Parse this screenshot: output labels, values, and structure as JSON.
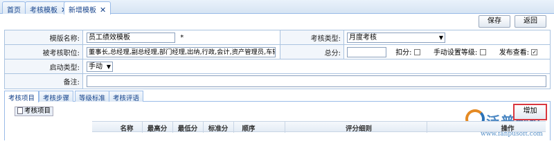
{
  "top_tabs": [
    {
      "label": "首页",
      "closable": false
    },
    {
      "label": "考核模板",
      "closable": true
    },
    {
      "label": "新增模板",
      "closable": true
    }
  ],
  "toolbar": {
    "save_label": "保存",
    "back_label": "返回"
  },
  "form": {
    "template_name_label": "模版名称:",
    "template_name_value": "员工绩效模板",
    "required_mark": "*",
    "assess_type_label": "考核类型:",
    "assess_type_value": "月度考核",
    "positions_label": "被考核职位:",
    "positions_value": "董事长,总经理,副总经理,部门经理,出纳,行政,会计,资产管理员,车辆调度",
    "total_label": "总分:",
    "total_value": "",
    "deduct_label": "扣分:",
    "manual_level_label": "手动设置等级:",
    "publish_label": "发布查看:",
    "start_type_label": "启动类型:",
    "start_type_value": "手动",
    "remark_label": "备注:",
    "remark_value": ""
  },
  "bottom_tabs": [
    "考核项目",
    "考核步骤",
    "等级标准",
    "考核评语"
  ],
  "tree": {
    "root_label": "考核项目"
  },
  "add_button": "增加",
  "grid": {
    "columns": [
      "名称",
      "最高分",
      "最低分",
      "标准分",
      "顺序",
      "评分细则",
      "操作"
    ]
  },
  "watermark": {
    "name": "泛普软件",
    "url": "www.fanpusoft.com"
  },
  "colors": {
    "accent": "#15428b",
    "highlight": "#d9363e",
    "logo_blue": "#2a72b8",
    "logo_orange": "#e58a23"
  }
}
